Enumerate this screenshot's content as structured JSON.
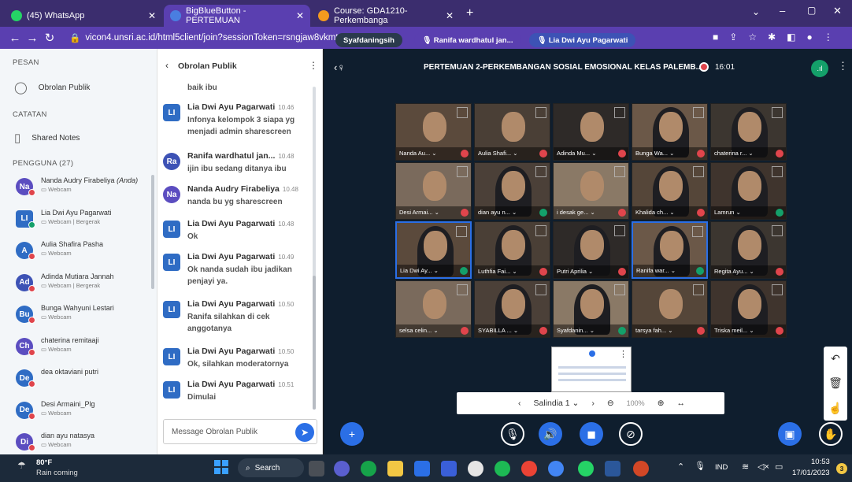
{
  "browser": {
    "tabs": [
      {
        "label": "(45) WhatsApp",
        "icon": "whatsapp-icon",
        "active": false
      },
      {
        "label": "BigBlueButton - PERTEMUAN",
        "icon": "bigbluebutton-icon",
        "active": true
      },
      {
        "label": "Course: GDA1210-Perkembanga",
        "icon": "moodle-icon",
        "active": false
      }
    ],
    "new_tab": "+",
    "url": "vicon4.unsri.ac.id/html5client/join?sessionToken=rsngjaw8vkmtqw1n"
  },
  "sidebar": {
    "pesan_heading": "PESAN",
    "public_chat": "Obrolan Publik",
    "catatan_heading": "CATATAN",
    "shared_notes": "Shared Notes",
    "users_heading": "PENGGUNA (27)",
    "users": [
      {
        "initials": "Na",
        "name": "Nanda Audry Firabeliya",
        "you": "(Anda)",
        "sub": "Webcam",
        "color": "#5b4dc0",
        "mic": "off",
        "square": false
      },
      {
        "initials": "LI",
        "name": "Lia Dwi Ayu Pagarwati",
        "you": "",
        "sub": "Webcam | Bergerak",
        "color": "#2f6cc4",
        "mic": "on",
        "square": true
      },
      {
        "initials": "A",
        "name": "Aulia Shafira Pasha",
        "you": "",
        "sub": "Webcam",
        "color": "#2f6cc4",
        "mic": "off",
        "square": false
      },
      {
        "initials": "Ad",
        "name": "Adinda Mutiara Jannah",
        "you": "",
        "sub": "Webcam | Bergerak",
        "color": "#3d52b5",
        "mic": "off",
        "square": false
      },
      {
        "initials": "Bu",
        "name": "Bunga Wahyuni Lestari",
        "you": "",
        "sub": "Webcam",
        "color": "#2f6cc4",
        "mic": "off",
        "square": false
      },
      {
        "initials": "Ch",
        "name": "chaterina remitaaji",
        "you": "",
        "sub": "Webcam",
        "color": "#5b4dc0",
        "mic": "off",
        "square": false
      },
      {
        "initials": "De",
        "name": "dea oktaviani putri",
        "you": "",
        "sub": "",
        "color": "#2f6cc4",
        "mic": "off",
        "square": false
      },
      {
        "initials": "De",
        "name": "Desi Armaini_Plg",
        "you": "",
        "sub": "Webcam",
        "color": "#2f6cc4",
        "mic": "off",
        "square": false
      },
      {
        "initials": "Di",
        "name": "dian ayu natasya",
        "you": "",
        "sub": "Webcam",
        "color": "#5b4dc0",
        "mic": "off",
        "square": false
      }
    ]
  },
  "chat": {
    "title": "Obrolan Publik",
    "back": "‹",
    "more": "⋮",
    "top_fragment": "baik ibu",
    "messages": [
      {
        "initials": "LI",
        "color": "#2f6cc4",
        "square": true,
        "name": "Lia Dwi Ayu Pagarwati",
        "time": "10.46",
        "text": "Infonya kelompok 3 siapa yg menjadi admin sharescreen"
      },
      {
        "initials": "Ra",
        "color": "#3d52b5",
        "square": false,
        "name": "Ranifa wardhatul jan...",
        "time": "10.48",
        "text": "ijin ibu sedang ditanya ibu"
      },
      {
        "initials": "Na",
        "color": "#5b4dc0",
        "square": false,
        "name": "Nanda Audry Firabeliya",
        "time": "10.48",
        "text": "nanda bu yg sharescreen"
      },
      {
        "initials": "LI",
        "color": "#2f6cc4",
        "square": true,
        "name": "Lia Dwi Ayu Pagarwati",
        "time": "10.48",
        "text": "Ok"
      },
      {
        "initials": "LI",
        "color": "#2f6cc4",
        "square": true,
        "name": "Lia Dwi Ayu Pagarwati",
        "time": "10.49",
        "text": "Ok nanda sudah ibu jadikan penjayi ya."
      },
      {
        "initials": "LI",
        "color": "#2f6cc4",
        "square": true,
        "name": "Lia Dwi Ayu Pagarwati",
        "time": "10.50",
        "text": "Ranifa silahkan di cek anggotanya"
      },
      {
        "initials": "LI",
        "color": "#2f6cc4",
        "square": true,
        "name": "Lia Dwi Ayu Pagarwati",
        "time": "10.50",
        "text": "Ok, silahkan moderatornya"
      },
      {
        "initials": "LI",
        "color": "#2f6cc4",
        "square": true,
        "name": "Lia Dwi Ayu Pagarwati",
        "time": "10.51",
        "text": "Dimulai"
      }
    ],
    "input_placeholder": "Message Obrolan Publik"
  },
  "meeting": {
    "title": "PERTEMUAN 2-PERKEMBANGAN SOSIAL EMOSIONAL KELAS PALEMB...",
    "recording_time": "16:01",
    "talkers": [
      "Syafdaningsih",
      "Ranifa wardhatul jan...",
      "Lia Dwi Ayu Pagarwati"
    ],
    "tiles": [
      {
        "label": "Nanda Au...",
        "mic": "off",
        "hijab": false
      },
      {
        "label": "Aulia Shafi...",
        "mic": "off",
        "hijab": false
      },
      {
        "label": "Adinda Mu...",
        "mic": "off",
        "hijab": false
      },
      {
        "label": "Bunga Wa...",
        "mic": "off",
        "hijab": true
      },
      {
        "label": "chaterina r...",
        "mic": "off",
        "hijab": true
      },
      {
        "label": "Desi Armai...",
        "mic": "off",
        "hijab": false
      },
      {
        "label": "dian ayu n...",
        "mic": "on",
        "hijab": true
      },
      {
        "label": "i desak ge...",
        "mic": "off",
        "hijab": false
      },
      {
        "label": "Khalida ch...",
        "mic": "off",
        "hijab": true
      },
      {
        "label": "Lamrun",
        "mic": "on",
        "hijab": true
      },
      {
        "label": "Lia Dwi Ay...",
        "mic": "on",
        "hijab": true
      },
      {
        "label": "Luthfia Fai...",
        "mic": "off",
        "hijab": true
      },
      {
        "label": "Putri Aprilia",
        "mic": "off",
        "hijab": true
      },
      {
        "label": "Ranifa war...",
        "mic": "on",
        "hijab": true
      },
      {
        "label": "Regita Ayu...",
        "mic": "off",
        "hijab": true
      },
      {
        "label": "selsa celin...",
        "mic": "off",
        "hijab": false
      },
      {
        "label": "SYABILLA ...",
        "mic": "off",
        "hijab": true
      },
      {
        "label": "Syafdanin...",
        "mic": "on",
        "hijab": true
      },
      {
        "label": "tarsya fah...",
        "mic": "off",
        "hijab": false
      },
      {
        "label": "Triska meil...",
        "mic": "off",
        "hijab": true
      }
    ],
    "slide_label": "Salindia 1",
    "zoom": "100%"
  },
  "taskbar": {
    "weather_temp": "80°F",
    "weather_desc": "Rain coming",
    "search": "Search",
    "lang": "IND",
    "time": "10:53",
    "date": "17/01/2023",
    "badge": "3"
  }
}
